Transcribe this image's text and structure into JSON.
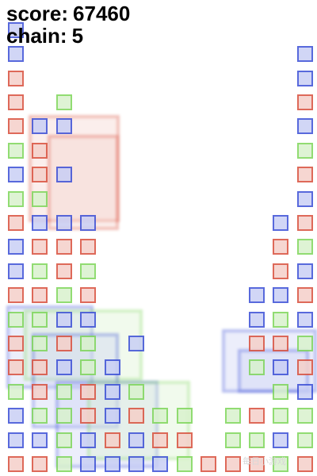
{
  "hud": {
    "score_label": "score:",
    "score_value": "67460",
    "chain_label": "chain:",
    "chain_value": "5"
  },
  "watermark": "毎日小游戏",
  "colors": {
    "blue_stroke": "#3b4fd6",
    "blue_fill": "#c9cff5",
    "red_stroke": "#d9503d",
    "red_fill": "#f5d0c9",
    "green_stroke": "#7ed65a",
    "green_fill": "#d9f2cd"
  },
  "board": {
    "columns": 13,
    "rows": 19,
    "cells": [
      "B............",
      "B...........B",
      "R...........B",
      "R.G.........R",
      "RBB.........B",
      "GR..........G",
      "BRB.........R",
      "GG..........B",
      "RBBB.......BR",
      "BRRR.......RG",
      "BGRG.......RB",
      "RRGR......BBR",
      "GGBB......BGB",
      "RGRG.B....RRG",
      "RRBGB.....GBR",
      "GRGRBG.....GB",
      "BGGRBRGG.GRGG",
      "BBGBRBRR.GGBG",
      "RRGBBBBGRRRGR"
    ]
  }
}
